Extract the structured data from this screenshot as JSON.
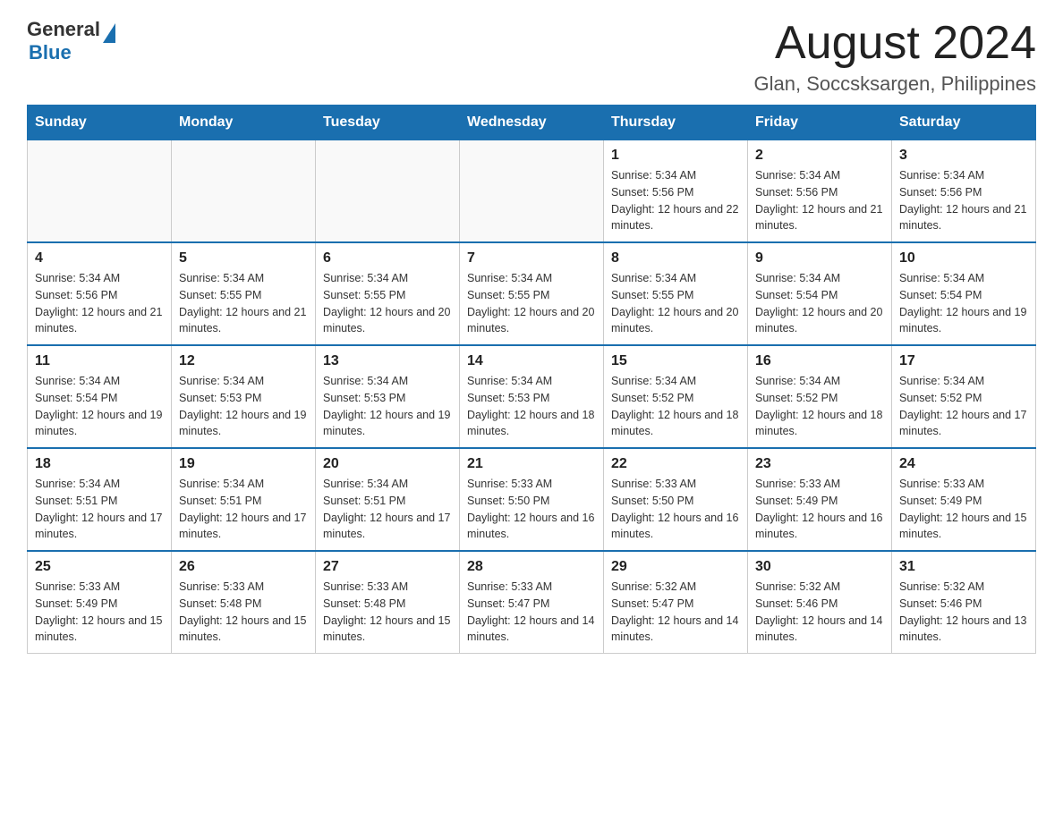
{
  "header": {
    "logo_general": "General",
    "logo_blue": "Blue",
    "month_title": "August 2024",
    "location": "Glan, Soccsksargen, Philippines"
  },
  "days_of_week": [
    "Sunday",
    "Monday",
    "Tuesday",
    "Wednesday",
    "Thursday",
    "Friday",
    "Saturday"
  ],
  "weeks": [
    [
      {
        "day": "",
        "info": ""
      },
      {
        "day": "",
        "info": ""
      },
      {
        "day": "",
        "info": ""
      },
      {
        "day": "",
        "info": ""
      },
      {
        "day": "1",
        "info": "Sunrise: 5:34 AM\nSunset: 5:56 PM\nDaylight: 12 hours and 22 minutes."
      },
      {
        "day": "2",
        "info": "Sunrise: 5:34 AM\nSunset: 5:56 PM\nDaylight: 12 hours and 21 minutes."
      },
      {
        "day": "3",
        "info": "Sunrise: 5:34 AM\nSunset: 5:56 PM\nDaylight: 12 hours and 21 minutes."
      }
    ],
    [
      {
        "day": "4",
        "info": "Sunrise: 5:34 AM\nSunset: 5:56 PM\nDaylight: 12 hours and 21 minutes."
      },
      {
        "day": "5",
        "info": "Sunrise: 5:34 AM\nSunset: 5:55 PM\nDaylight: 12 hours and 21 minutes."
      },
      {
        "day": "6",
        "info": "Sunrise: 5:34 AM\nSunset: 5:55 PM\nDaylight: 12 hours and 20 minutes."
      },
      {
        "day": "7",
        "info": "Sunrise: 5:34 AM\nSunset: 5:55 PM\nDaylight: 12 hours and 20 minutes."
      },
      {
        "day": "8",
        "info": "Sunrise: 5:34 AM\nSunset: 5:55 PM\nDaylight: 12 hours and 20 minutes."
      },
      {
        "day": "9",
        "info": "Sunrise: 5:34 AM\nSunset: 5:54 PM\nDaylight: 12 hours and 20 minutes."
      },
      {
        "day": "10",
        "info": "Sunrise: 5:34 AM\nSunset: 5:54 PM\nDaylight: 12 hours and 19 minutes."
      }
    ],
    [
      {
        "day": "11",
        "info": "Sunrise: 5:34 AM\nSunset: 5:54 PM\nDaylight: 12 hours and 19 minutes."
      },
      {
        "day": "12",
        "info": "Sunrise: 5:34 AM\nSunset: 5:53 PM\nDaylight: 12 hours and 19 minutes."
      },
      {
        "day": "13",
        "info": "Sunrise: 5:34 AM\nSunset: 5:53 PM\nDaylight: 12 hours and 19 minutes."
      },
      {
        "day": "14",
        "info": "Sunrise: 5:34 AM\nSunset: 5:53 PM\nDaylight: 12 hours and 18 minutes."
      },
      {
        "day": "15",
        "info": "Sunrise: 5:34 AM\nSunset: 5:52 PM\nDaylight: 12 hours and 18 minutes."
      },
      {
        "day": "16",
        "info": "Sunrise: 5:34 AM\nSunset: 5:52 PM\nDaylight: 12 hours and 18 minutes."
      },
      {
        "day": "17",
        "info": "Sunrise: 5:34 AM\nSunset: 5:52 PM\nDaylight: 12 hours and 17 minutes."
      }
    ],
    [
      {
        "day": "18",
        "info": "Sunrise: 5:34 AM\nSunset: 5:51 PM\nDaylight: 12 hours and 17 minutes."
      },
      {
        "day": "19",
        "info": "Sunrise: 5:34 AM\nSunset: 5:51 PM\nDaylight: 12 hours and 17 minutes."
      },
      {
        "day": "20",
        "info": "Sunrise: 5:34 AM\nSunset: 5:51 PM\nDaylight: 12 hours and 17 minutes."
      },
      {
        "day": "21",
        "info": "Sunrise: 5:33 AM\nSunset: 5:50 PM\nDaylight: 12 hours and 16 minutes."
      },
      {
        "day": "22",
        "info": "Sunrise: 5:33 AM\nSunset: 5:50 PM\nDaylight: 12 hours and 16 minutes."
      },
      {
        "day": "23",
        "info": "Sunrise: 5:33 AM\nSunset: 5:49 PM\nDaylight: 12 hours and 16 minutes."
      },
      {
        "day": "24",
        "info": "Sunrise: 5:33 AM\nSunset: 5:49 PM\nDaylight: 12 hours and 15 minutes."
      }
    ],
    [
      {
        "day": "25",
        "info": "Sunrise: 5:33 AM\nSunset: 5:49 PM\nDaylight: 12 hours and 15 minutes."
      },
      {
        "day": "26",
        "info": "Sunrise: 5:33 AM\nSunset: 5:48 PM\nDaylight: 12 hours and 15 minutes."
      },
      {
        "day": "27",
        "info": "Sunrise: 5:33 AM\nSunset: 5:48 PM\nDaylight: 12 hours and 15 minutes."
      },
      {
        "day": "28",
        "info": "Sunrise: 5:33 AM\nSunset: 5:47 PM\nDaylight: 12 hours and 14 minutes."
      },
      {
        "day": "29",
        "info": "Sunrise: 5:32 AM\nSunset: 5:47 PM\nDaylight: 12 hours and 14 minutes."
      },
      {
        "day": "30",
        "info": "Sunrise: 5:32 AM\nSunset: 5:46 PM\nDaylight: 12 hours and 14 minutes."
      },
      {
        "day": "31",
        "info": "Sunrise: 5:32 AM\nSunset: 5:46 PM\nDaylight: 12 hours and 13 minutes."
      }
    ]
  ]
}
